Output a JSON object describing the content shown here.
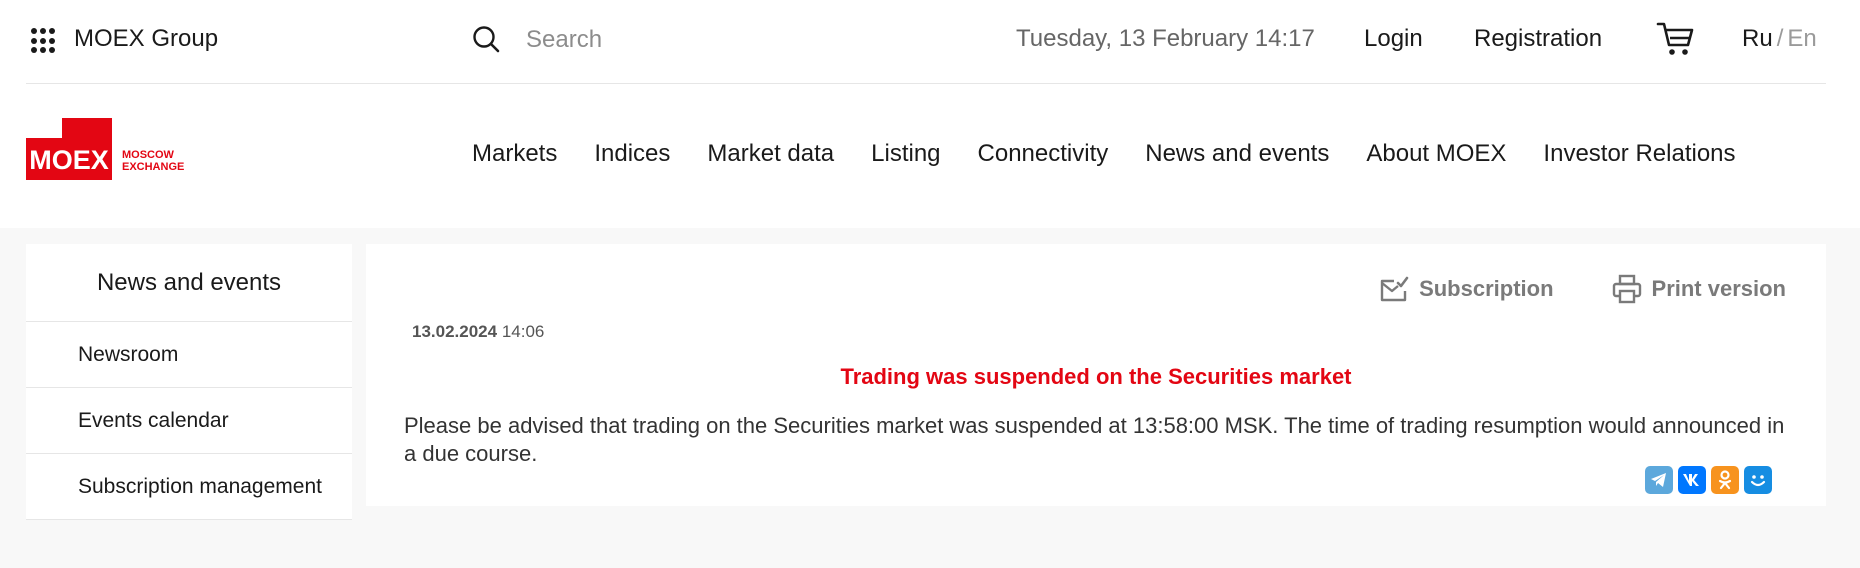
{
  "header": {
    "group_label": "MOEX Group",
    "search_placeholder": "Search",
    "datetime": "Tuesday, 13 February 14:17",
    "login": "Login",
    "registration": "Registration",
    "lang_ru": "Ru",
    "lang_sep": "/",
    "lang_en": "En"
  },
  "logo": {
    "mark": "MOEX",
    "line1": "MOSCOW",
    "line2": "EXCHANGE",
    "color": "#e30613"
  },
  "nav": {
    "items": [
      "Markets",
      "Indices",
      "Market data",
      "Listing",
      "Connectivity",
      "News and events",
      "About MOEX",
      "Investor Relations"
    ]
  },
  "sidebar": {
    "title": "News and events",
    "items": [
      "Newsroom",
      "Events calendar",
      "Subscription management"
    ]
  },
  "article": {
    "subscription": "Subscription",
    "print_version": "Print version",
    "date": "13.02.2024",
    "time": "14:06",
    "title": "Trading was suspended on the Securities market",
    "body": "Please be advised that trading on the Securities market was suspended at 13:58:00 MSK. The time of trading resumption would announced in a due course.",
    "title_color": "#e30613"
  },
  "share": {
    "icons": [
      "telegram-icon",
      "vk-icon",
      "odnoklassniki-icon",
      "moimir-icon"
    ],
    "colors": [
      "#5ca8dc",
      "#0077ff",
      "#f7931e",
      "#168de2"
    ]
  }
}
